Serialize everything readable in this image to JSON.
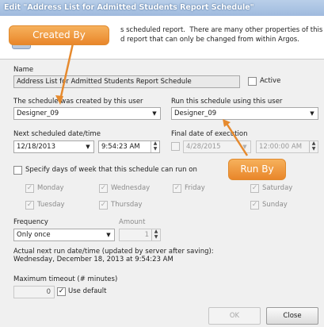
{
  "window": {
    "title": "Edit \"Address List for Admitted Students Report Schedule\""
  },
  "info": {
    "text": "s scheduled report.  There are many other properties of this\nd report that can only be changed from within Argos."
  },
  "name": {
    "label": "Name",
    "value": "Address List for Admitted Students Report Schedule",
    "active_label": "Active",
    "active_checked": false
  },
  "created_by": {
    "label": "The schedule was created by this user",
    "value": "Designer_09"
  },
  "run_as": {
    "label": "Run this schedule using this user",
    "value": "Designer_09"
  },
  "next_run": {
    "label": "Next scheduled date/time",
    "date": "12/18/2013",
    "time": "9:54:23 AM"
  },
  "final_run": {
    "label": "Final date of execution",
    "date": "4/28/2015",
    "time": "12:00:00 AM",
    "checked": false
  },
  "days": {
    "toggle_label": "Specify days of week that this schedule can run on",
    "toggle_checked": false,
    "items": [
      {
        "label": "Monday",
        "checked": true
      },
      {
        "label": "Wednesday",
        "checked": true
      },
      {
        "label": "Friday",
        "checked": true
      },
      {
        "label": "Saturday",
        "checked": true
      },
      {
        "label": "Tuesday",
        "checked": true
      },
      {
        "label": "Thursday",
        "checked": true
      },
      {
        "label": "Sunday",
        "checked": true
      }
    ]
  },
  "frequency": {
    "label": "Frequency",
    "value": "Only once",
    "amount_label": "Amount",
    "amount": "1"
  },
  "next_actual": {
    "label": "Actual next run date/time (updated by server after saving):",
    "value": "Wednesday, December 18, 2013 at 9:54:23 AM"
  },
  "timeout": {
    "label": "Maximum timeout (# minutes)",
    "value": "0",
    "use_default_label": "Use default",
    "use_default_checked": true
  },
  "buttons": {
    "ok": "OK",
    "close": "Close"
  },
  "callouts": {
    "created_by": "Created By",
    "run_by": "Run By"
  },
  "colors": {
    "callout": "#f0a040",
    "titlebar": "#a9c2e2"
  }
}
